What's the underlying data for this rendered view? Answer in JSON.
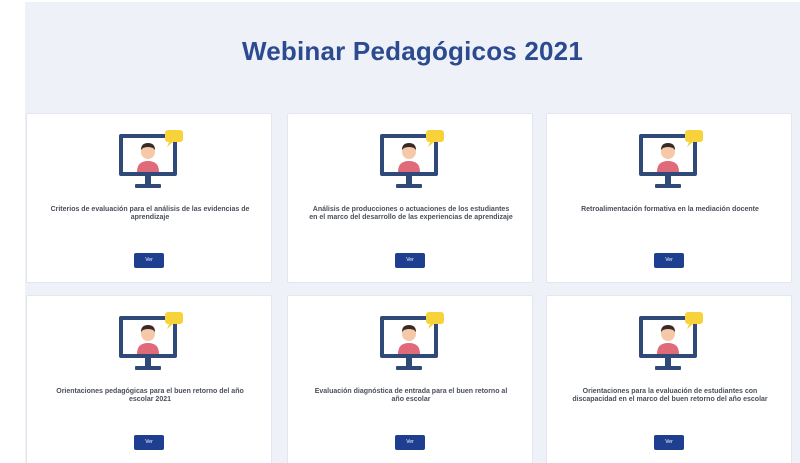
{
  "header": {
    "title": "Webinar Pedagógicos 2021"
  },
  "colors": {
    "title": "#2b4a8f",
    "background": "#eef2f8",
    "card": "#ffffff",
    "button": "#1e3f8f",
    "monitor_frame": "#2f4a78",
    "screen": "#ffffff",
    "person_shirt": "#e06a7a",
    "skin": "#f5c9a8",
    "hair": "#3a2a26",
    "chat_bubble": "#f7d23b"
  },
  "cards": [
    {
      "icon": "monitor-video-call-icon",
      "label": "Criterios de evaluación para el análisis de las evidencias de aprendizaje",
      "button_label": "Ver"
    },
    {
      "icon": "monitor-video-call-icon",
      "label": "Análisis de producciones o actuaciones de los estudiantes en el marco del desarrollo de las experiencias de aprendizaje",
      "button_label": "Ver"
    },
    {
      "icon": "monitor-video-call-icon",
      "label": "Retroalimentación formativa en la mediación docente",
      "button_label": "Ver"
    },
    {
      "icon": "monitor-video-call-icon",
      "label": "Orientaciones pedagógicas para el buen retorno del año escolar 2021",
      "button_label": "Ver"
    },
    {
      "icon": "monitor-video-call-icon",
      "label": "Evaluación diagnóstica de entrada para el buen retorno al año escolar",
      "button_label": "Ver"
    },
    {
      "icon": "monitor-video-call-icon",
      "label": "Orientaciones para la evaluación de estudiantes con discapacidad en el marco del buen retorno del año escolar",
      "button_label": "Ver"
    }
  ]
}
